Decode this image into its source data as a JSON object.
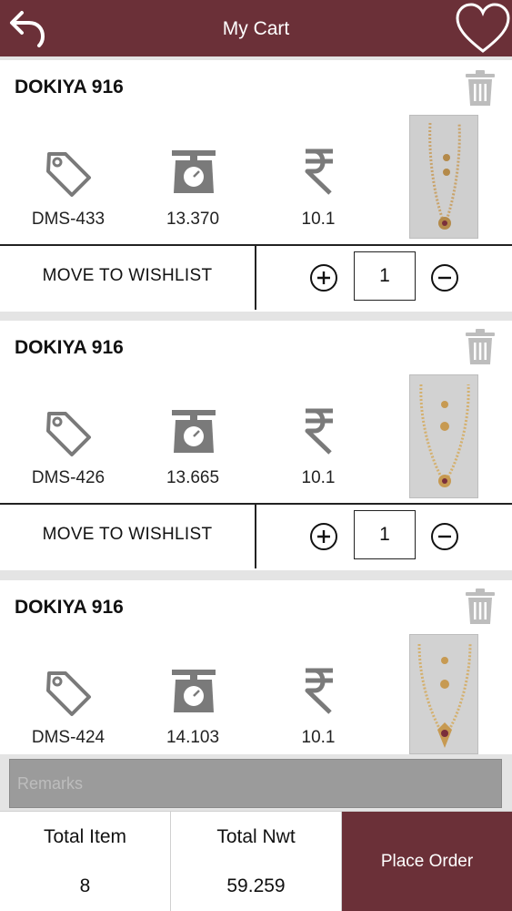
{
  "header": {
    "title": "My Cart",
    "back_icon": "back-arrow-icon",
    "wishlist_icon": "heart-icon"
  },
  "colors": {
    "brand": "#6b3038",
    "icon_gray": "#7a7a7a"
  },
  "items": [
    {
      "name": "DOKIYA 916",
      "code": "DMS-433",
      "weight": "13.370",
      "rate": "10.1",
      "qty": "1",
      "wishlist_label": "MOVE TO WISHLIST"
    },
    {
      "name": "DOKIYA 916",
      "code": "DMS-426",
      "weight": "13.665",
      "rate": "10.1",
      "qty": "1",
      "wishlist_label": "MOVE TO WISHLIST"
    },
    {
      "name": "DOKIYA 916",
      "code": "DMS-424",
      "weight": "14.103",
      "rate": "10.1"
    }
  ],
  "remarks": {
    "placeholder": "Remarks"
  },
  "footer": {
    "total_item_label": "Total Item",
    "total_item_value": "8",
    "total_nwt_label": "Total Nwt",
    "total_nwt_value": "59.259",
    "place_order_label": "Place Order"
  }
}
